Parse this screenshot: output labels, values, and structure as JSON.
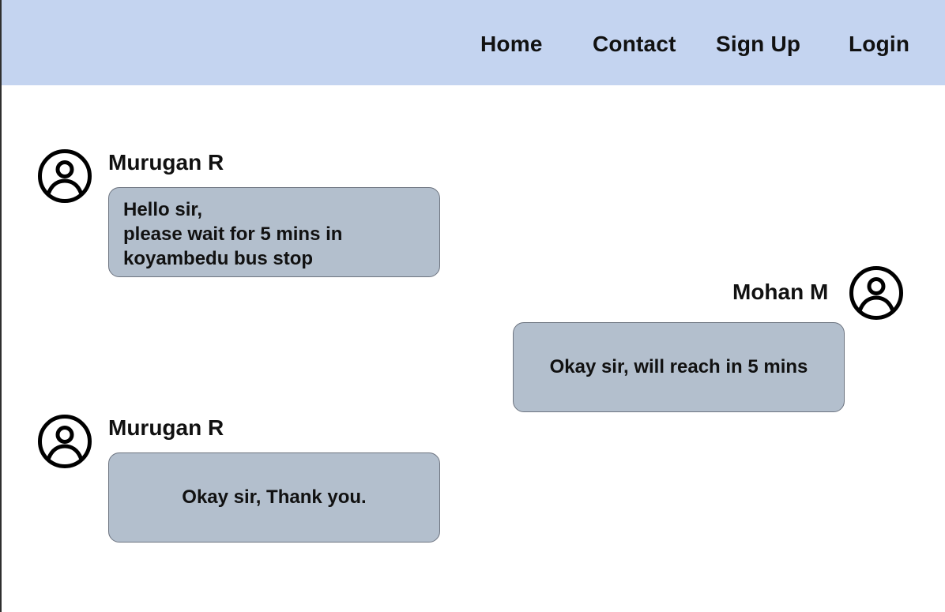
{
  "nav": {
    "home": "Home",
    "contact": "Contact",
    "signup": "Sign Up",
    "login": "Login"
  },
  "messages": [
    {
      "sender": "Murugan R",
      "text": "Hello sir,\nplease wait for 5 mins in\nkoyambedu bus stop",
      "side": "left"
    },
    {
      "sender": "Mohan M",
      "text": "Okay sir, will reach in 5 mins",
      "side": "right"
    },
    {
      "sender": "Murugan R",
      "text": "Okay sir, Thank you.",
      "side": "left"
    }
  ],
  "icons": {
    "avatar": "user-circle-icon"
  },
  "colors": {
    "navbar_bg": "#c4d4f0",
    "bubble_bg": "#b3bfcd"
  }
}
